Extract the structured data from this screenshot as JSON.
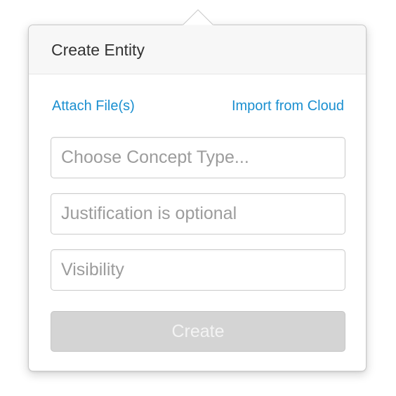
{
  "popover": {
    "title": "Create Entity"
  },
  "links": {
    "attach": "Attach File(s)",
    "import": "Import from Cloud"
  },
  "fields": {
    "concept_type": {
      "placeholder": "Choose Concept Type...",
      "value": ""
    },
    "justification": {
      "placeholder": "Justification is optional",
      "value": ""
    },
    "visibility": {
      "placeholder": "Visibility",
      "value": ""
    }
  },
  "actions": {
    "create_label": "Create",
    "create_disabled": true
  },
  "colors": {
    "link": "#1a8fd0",
    "header_bg": "#f7f7f7",
    "button_disabled_bg": "#d4d4d4",
    "button_disabled_text": "#f3f3f3",
    "placeholder": "#9c9c9c"
  }
}
